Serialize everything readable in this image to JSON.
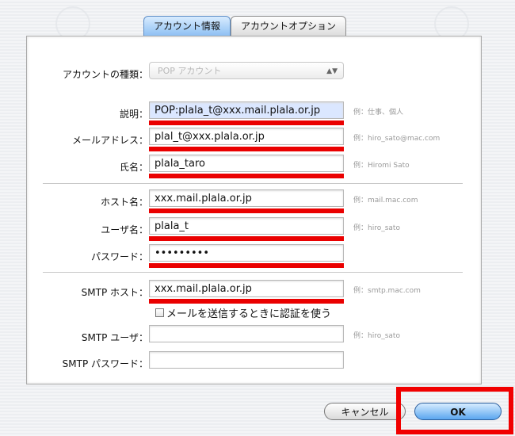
{
  "tabs": [
    "アカウント情報",
    "アカウントオプション"
  ],
  "account_type": {
    "label": "アカウントの種類：",
    "value": "POP アカウント"
  },
  "fields": [
    {
      "label": "説明：",
      "value": "POP:plala_t@xxx.mail.plala.or.jp",
      "example": "例：仕事、個人"
    },
    {
      "label": "メールアドレス：",
      "value": "plal_t@xxx.plala.or.jp",
      "example": "例：hiro_sato@mac.com"
    },
    {
      "label": "氏名：",
      "value": "plala_taro",
      "example": "例：Hiromi Sato"
    },
    {
      "label": "ホスト名：",
      "value": "xxx.mail.plala.or.jp",
      "example": "例：mail.mac.com"
    },
    {
      "label": "ユーザ名：",
      "value": "plala_t",
      "example": "例：hiro_sato"
    },
    {
      "label": "パスワード：",
      "value": "•••••••••",
      "example": ""
    },
    {
      "label": "SMTP ホスト：",
      "value": "xxx.mail.plala.or.jp",
      "example": "例：smtp.mac.com"
    }
  ],
  "auth_checkbox": {
    "label": "メールを送信するときに認証を使う",
    "checked": false
  },
  "smtp_user": {
    "label": "SMTP ユーザ：",
    "value": "",
    "example": "例：hiro_sato"
  },
  "smtp_password": {
    "label": "SMTP パスワード：",
    "value": ""
  },
  "buttons": {
    "cancel": "キャンセル",
    "ok": "OK"
  },
  "highlight_color": "#ea0000"
}
